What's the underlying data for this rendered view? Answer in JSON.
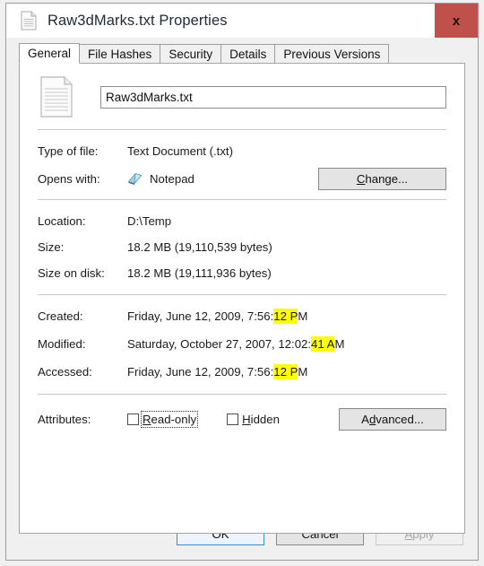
{
  "window": {
    "title": "Raw3dMarks.txt Properties",
    "title_icon": "document-icon",
    "close_label": "x",
    "close_color": "#c0504a"
  },
  "tabs": [
    {
      "label": "General",
      "active": true
    },
    {
      "label": "File Hashes",
      "active": false
    },
    {
      "label": "Security",
      "active": false
    },
    {
      "label": "Details",
      "active": false
    },
    {
      "label": "Previous Versions",
      "active": false
    }
  ],
  "general": {
    "file_icon": "text-document-icon",
    "filename_value": "Raw3dMarks.txt",
    "type_of_file_label": "Type of file:",
    "type_of_file_value": "Text Document (.txt)",
    "opens_with_label": "Opens with:",
    "opens_with_app": "Notepad",
    "opens_with_icon": "notepad-icon",
    "change_button": "Change...",
    "location_label": "Location:",
    "location_value": "D:\\Temp",
    "size_label": "Size:",
    "size_value": "18.2 MB (19,110,539 bytes)",
    "size_on_disk_label": "Size on disk:",
    "size_on_disk_value": "18.2 MB (19,111,936 bytes)",
    "created_label": "Created:",
    "created": {
      "prefix": "Friday, June 12, 2009, 7:56:",
      "highlight": "12 P",
      "suffix": "M"
    },
    "modified_label": "Modified:",
    "modified": {
      "prefix": "Saturday, October 27, 2007, 12:02:",
      "highlight": "41 A",
      "suffix": "M"
    },
    "accessed_label": "Accessed:",
    "accessed": {
      "prefix": "Friday, June 12, 2009, 7:56:",
      "highlight": "12 P",
      "suffix": "M"
    },
    "attributes_label": "Attributes:",
    "readonly_label": "Read-only",
    "readonly_checked": false,
    "hidden_label": "Hidden",
    "hidden_checked": false,
    "advanced_button": "Advanced..."
  },
  "footer": {
    "ok": "OK",
    "cancel": "Cancel",
    "apply": "Apply",
    "apply_disabled": true
  },
  "colors": {
    "highlight": "#ffff00",
    "accent": "#3c8ad4",
    "close_red": "#c0504a"
  }
}
